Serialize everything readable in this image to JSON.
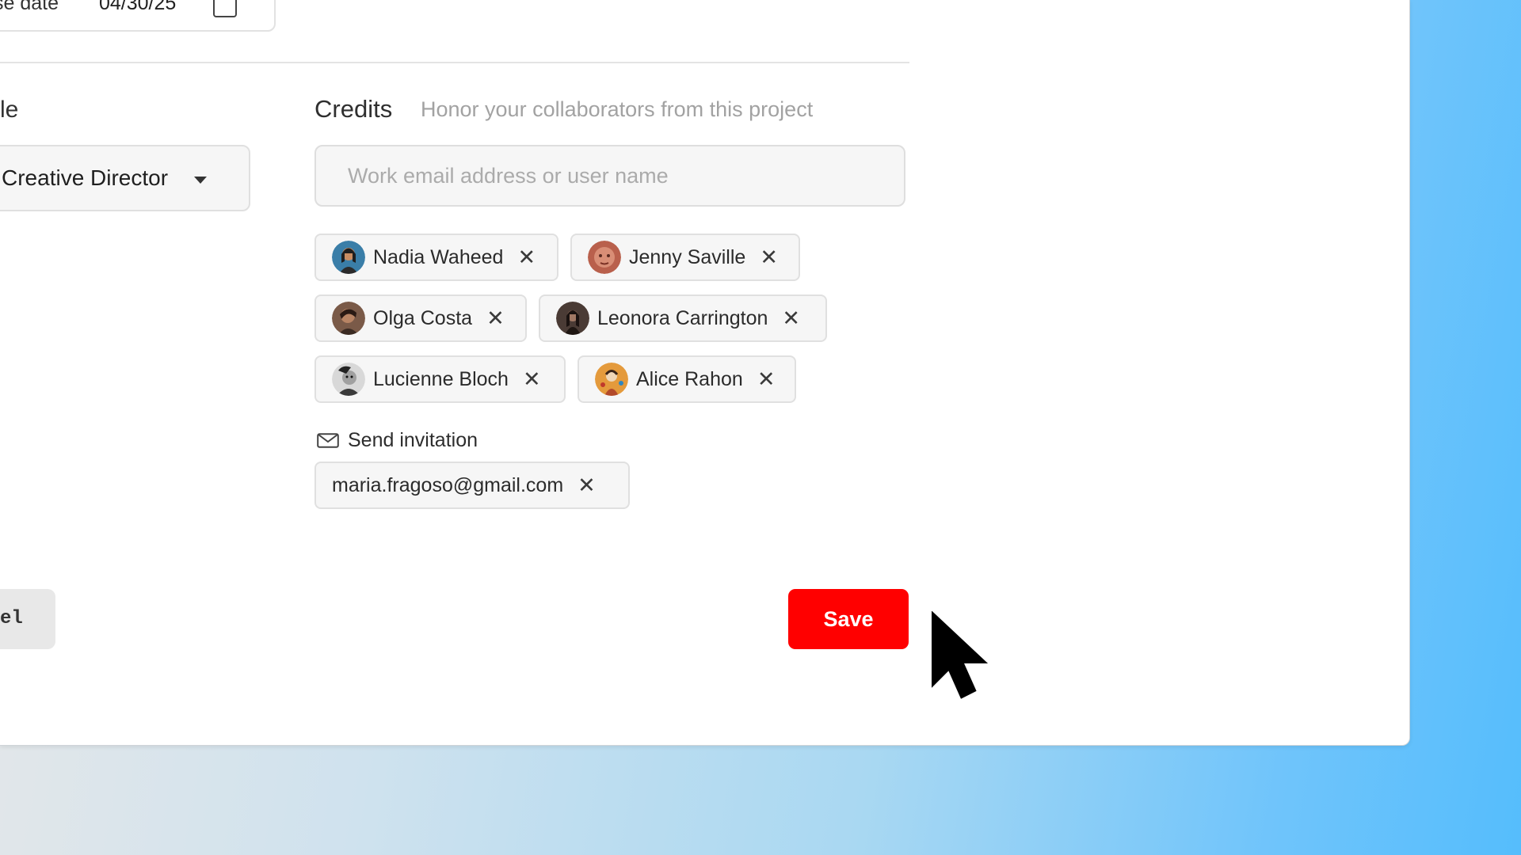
{
  "form": {
    "date_label": "se date",
    "date_value": "04/30/25"
  },
  "role": {
    "label": "le",
    "selected": "Creative Director"
  },
  "credits": {
    "title": "Credits",
    "subtitle": "Honor your collaborators from this project",
    "search_placeholder": "Work email address or user name",
    "collaborators": [
      {
        "name": "Nadia Waheed",
        "avatar_color": "#3a7ea8"
      },
      {
        "name": "Jenny Saville",
        "avatar_color": "#b9604c"
      },
      {
        "name": "Olga Costa",
        "avatar_color": "#7a5a48"
      },
      {
        "name": "Leonora Carrington",
        "avatar_color": "#4a3b35"
      },
      {
        "name": "Lucienne Bloch",
        "avatar_color": "#8c8c8c"
      },
      {
        "name": "Alice Rahon",
        "avatar_color": "#e49a3c"
      }
    ],
    "remove_glyph": "✕"
  },
  "invitation": {
    "label": "Send invitation",
    "emails": [
      "maria.fragoso@gmail.com"
    ]
  },
  "actions": {
    "cancel_label": "el",
    "save_label": "Save",
    "save_color": "#ff0000"
  }
}
